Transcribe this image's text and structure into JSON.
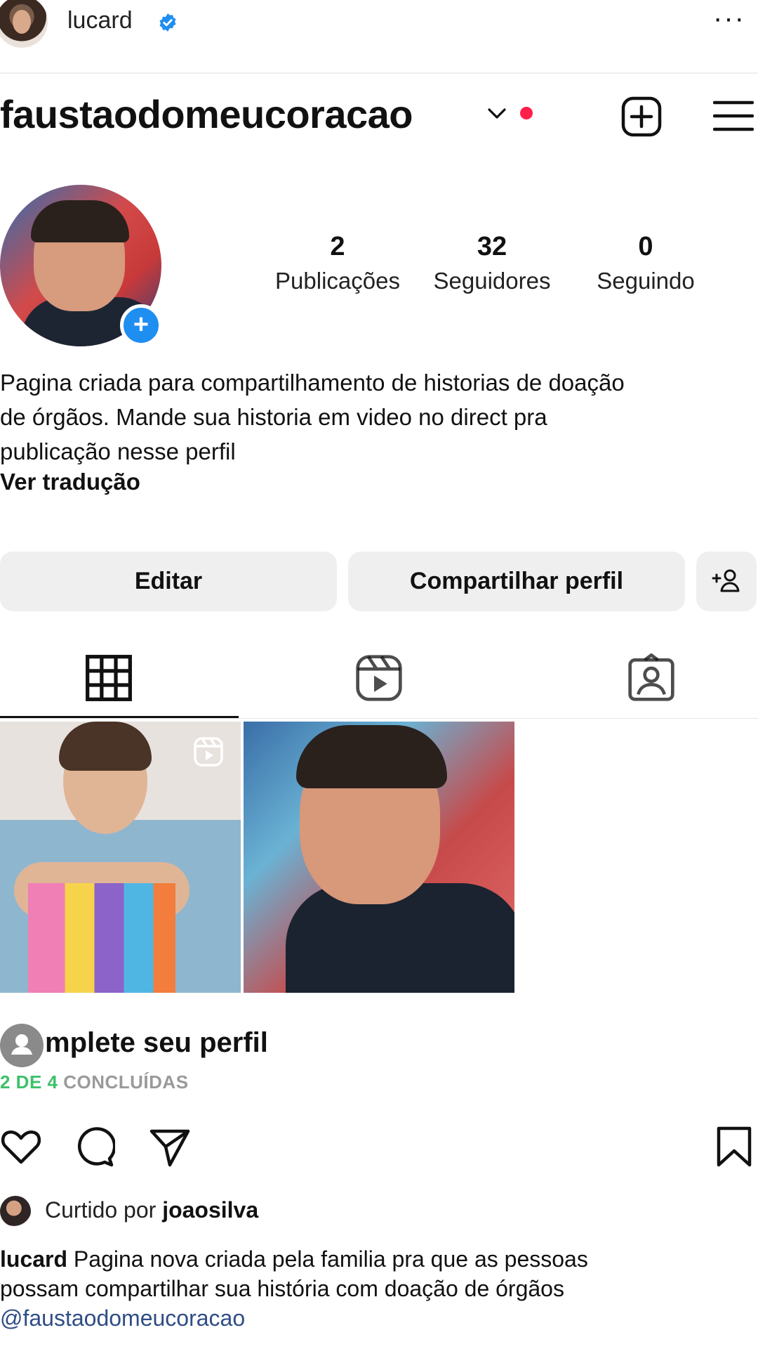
{
  "top": {
    "username": "lucard",
    "more_label": "···"
  },
  "profile": {
    "handle": "faustaodomeucoracao",
    "stats": [
      {
        "value": "2",
        "label": "Publicações"
      },
      {
        "value": "32",
        "label": "Seguidores"
      },
      {
        "value": "0",
        "label": "Seguindo"
      }
    ],
    "bio_lines": [
      "Pagina criada para compartilhamento de historias de doação",
      "de órgãos. Mande sua historia em video no direct pra",
      "publicação nesse perfil"
    ],
    "translate_label": "Ver tradução",
    "add_story_symbol": "+"
  },
  "buttons": {
    "edit": "Editar",
    "share": "Compartilhar perfil"
  },
  "complete": {
    "title": "mplete seu perfil",
    "progress_done": "2 DE 4",
    "progress_rest": " CONCLUÍDAS"
  },
  "post": {
    "liked_prefix": "Curtido por ",
    "liked_user": "joaosilva",
    "caption_user": "lucard",
    "caption_line1": " Pagina nova criada pela familia pra que as pessoas",
    "caption_line2": "possam compartilhar sua história com doação de órgãos",
    "mention": "@faustaodomeucoracao"
  },
  "colors": {
    "verified": "#1f8ef1",
    "live_dot": "#ff1f4b",
    "progress_done": "#3ec06b",
    "mention": "#2f4d86"
  },
  "icons": [
    "verified-badge-icon",
    "chevron-down-icon",
    "new-post-icon",
    "menu-icon",
    "add-story-icon",
    "add-friend-icon",
    "grid-icon",
    "reels-icon",
    "tagged-icon",
    "reel-indicator-icon",
    "heart-icon",
    "comment-icon",
    "share-icon",
    "bookmark-icon",
    "user-icon"
  ]
}
